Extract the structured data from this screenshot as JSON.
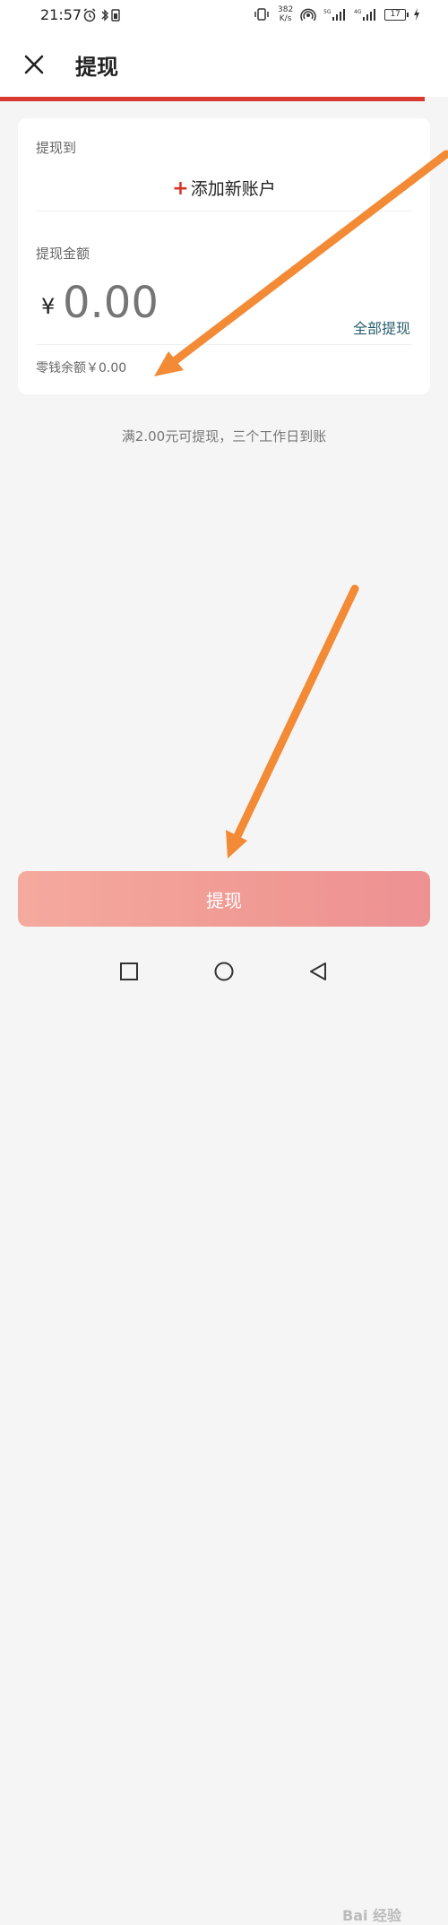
{
  "status_bar": {
    "time": "21:57",
    "network_speed_value": "382",
    "network_speed_unit": "K/s",
    "battery": "17"
  },
  "header": {
    "title": "提现"
  },
  "withdraw_to": {
    "label": "提现到",
    "add_account_plus": "+",
    "add_account_label": "添加新账户"
  },
  "amount": {
    "label": "提现金额",
    "currency_symbol": "¥",
    "placeholder": "0.00",
    "withdraw_all_label": "全部提现",
    "balance_text": "零钱余额￥0.00"
  },
  "tip": "满2.00元可提现，三个工作日到账",
  "submit_label": "提现",
  "watermark": "Bai 经验",
  "colors": {
    "accent_red": "#d83a2f",
    "button_gradient_start": "#f5aa9e",
    "button_gradient_end": "#ee9193",
    "link_teal": "#2a5f6c",
    "arrow_orange": "#f28a36"
  }
}
